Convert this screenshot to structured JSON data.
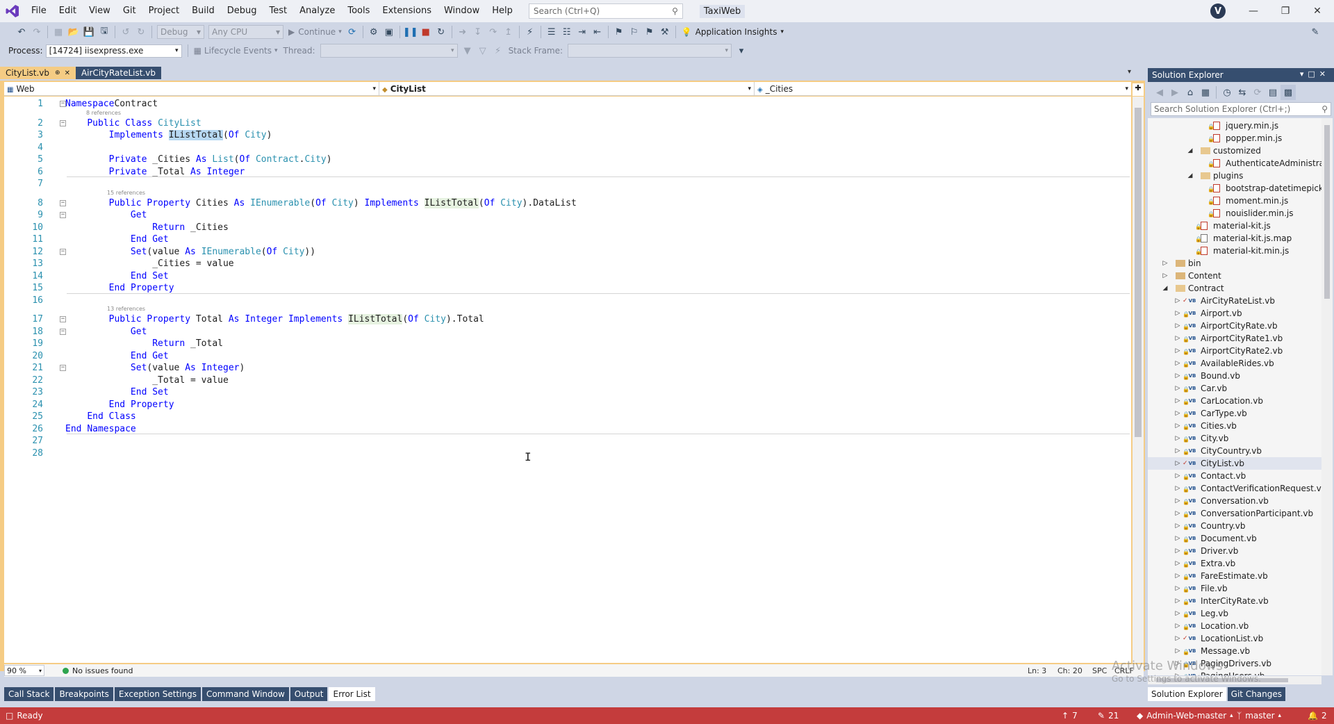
{
  "titlebar": {
    "menu": [
      "File",
      "Edit",
      "View",
      "Git",
      "Project",
      "Build",
      "Debug",
      "Test",
      "Analyze",
      "Tools",
      "Extensions",
      "Window",
      "Help"
    ],
    "search_placeholder": "Search (Ctrl+Q)",
    "solution_name": "TaxiWeb",
    "avatar_initial": "V"
  },
  "toolbar": {
    "config": "Debug",
    "platform": "Any CPU",
    "continue_label": "Continue",
    "app_insights_label": "Application Insights"
  },
  "debug_bar": {
    "process_label": "Process:",
    "process_value": "[14724] iisexpress.exe",
    "lifecycle_label": "Lifecycle Events",
    "thread_label": "Thread:",
    "stack_frame_label": "Stack Frame:"
  },
  "tabs": [
    {
      "label": "CityList.vb",
      "active": true
    },
    {
      "label": "AirCityRateList.vb",
      "active": false
    }
  ],
  "navbar": {
    "project": "Web",
    "type": "CityList",
    "member": "_Cities"
  },
  "code": {
    "lines": [
      {
        "n": "1",
        "tokens": [
          [
            "kw",
            "Namespace"
          ],
          [
            "",
            "Contract"
          ]
        ]
      },
      {
        "n": "2",
        "tokens": [
          [
            "",
            "    "
          ],
          [
            "kw",
            "Public"
          ],
          [
            "",
            " "
          ],
          [
            "kw",
            "Class"
          ],
          [
            "",
            " "
          ],
          [
            "ty",
            "CityList"
          ]
        ]
      },
      {
        "n": "3",
        "tokens": [
          [
            "",
            "        "
          ],
          [
            "kw",
            "Implements"
          ],
          [
            "",
            " "
          ],
          [
            "hl",
            "IListTotal"
          ],
          [
            "",
            "("
          ],
          [
            "kw",
            "Of"
          ],
          [
            "",
            " "
          ],
          [
            "ty",
            "City"
          ],
          [
            "",
            ")"
          ]
        ]
      },
      {
        "n": "4",
        "tokens": []
      },
      {
        "n": "5",
        "tokens": [
          [
            "",
            "        "
          ],
          [
            "kw",
            "Private"
          ],
          [
            "",
            " _Cities "
          ],
          [
            "kw",
            "As"
          ],
          [
            "",
            " "
          ],
          [
            "ty",
            "List"
          ],
          [
            "",
            "("
          ],
          [
            "kw",
            "Of"
          ],
          [
            "",
            " "
          ],
          [
            "ty",
            "Contract"
          ],
          [
            "",
            "."
          ],
          [
            "ty",
            "City"
          ],
          [
            "",
            ")"
          ]
        ]
      },
      {
        "n": "6",
        "tokens": [
          [
            "",
            "        "
          ],
          [
            "kw",
            "Private"
          ],
          [
            "",
            " _Total "
          ],
          [
            "kw",
            "As"
          ],
          [
            "",
            " "
          ],
          [
            "kw",
            "Integer"
          ]
        ]
      },
      {
        "n": "7",
        "tokens": []
      },
      {
        "n": "8",
        "tokens": [
          [
            "",
            "        "
          ],
          [
            "kw",
            "Public"
          ],
          [
            "",
            " "
          ],
          [
            "kw",
            "Property"
          ],
          [
            "",
            " Cities "
          ],
          [
            "kw",
            "As"
          ],
          [
            "",
            " "
          ],
          [
            "ty",
            "IEnumerable"
          ],
          [
            "",
            "("
          ],
          [
            "kw",
            "Of"
          ],
          [
            "",
            " "
          ],
          [
            "ty",
            "City"
          ],
          [
            "",
            ") "
          ],
          [
            "kw",
            "Implements"
          ],
          [
            "",
            " "
          ],
          [
            "ul",
            "IListTotal"
          ],
          [
            "",
            "("
          ],
          [
            "kw",
            "Of"
          ],
          [
            "",
            " "
          ],
          [
            "ty",
            "City"
          ],
          [
            "",
            ").DataList"
          ]
        ]
      },
      {
        "n": "9",
        "tokens": [
          [
            "",
            "            "
          ],
          [
            "kw",
            "Get"
          ]
        ]
      },
      {
        "n": "10",
        "tokens": [
          [
            "",
            "                "
          ],
          [
            "kw",
            "Return"
          ],
          [
            "",
            " _Cities"
          ]
        ]
      },
      {
        "n": "11",
        "tokens": [
          [
            "",
            "            "
          ],
          [
            "kw",
            "End"
          ],
          [
            "",
            " "
          ],
          [
            "kw",
            "Get"
          ]
        ]
      },
      {
        "n": "12",
        "tokens": [
          [
            "",
            "            "
          ],
          [
            "kw",
            "Set"
          ],
          [
            "",
            "(value "
          ],
          [
            "kw",
            "As"
          ],
          [
            "",
            " "
          ],
          [
            "ty",
            "IEnumerable"
          ],
          [
            "",
            "("
          ],
          [
            "kw",
            "Of"
          ],
          [
            "",
            " "
          ],
          [
            "ty",
            "City"
          ],
          [
            "",
            "))"
          ]
        ]
      },
      {
        "n": "13",
        "tokens": [
          [
            "",
            "                _Cities = value"
          ]
        ]
      },
      {
        "n": "14",
        "tokens": [
          [
            "",
            "            "
          ],
          [
            "kw",
            "End"
          ],
          [
            "",
            " "
          ],
          [
            "kw",
            "Set"
          ]
        ]
      },
      {
        "n": "15",
        "tokens": [
          [
            "",
            "        "
          ],
          [
            "kw",
            "End"
          ],
          [
            "",
            " "
          ],
          [
            "kw",
            "Property"
          ]
        ]
      },
      {
        "n": "16",
        "tokens": []
      },
      {
        "n": "17",
        "tokens": [
          [
            "",
            "        "
          ],
          [
            "kw",
            "Public"
          ],
          [
            "",
            " "
          ],
          [
            "kw",
            "Property"
          ],
          [
            "",
            " Total "
          ],
          [
            "kw",
            "As"
          ],
          [
            "",
            " "
          ],
          [
            "kw",
            "Integer"
          ],
          [
            "",
            " "
          ],
          [
            "kw",
            "Implements"
          ],
          [
            "",
            " "
          ],
          [
            "ul",
            "IListTotal"
          ],
          [
            "",
            "("
          ],
          [
            "kw",
            "Of"
          ],
          [
            "",
            " "
          ],
          [
            "ty",
            "City"
          ],
          [
            "",
            ").Total"
          ]
        ]
      },
      {
        "n": "18",
        "tokens": [
          [
            "",
            "            "
          ],
          [
            "kw",
            "Get"
          ]
        ]
      },
      {
        "n": "19",
        "tokens": [
          [
            "",
            "                "
          ],
          [
            "kw",
            "Return"
          ],
          [
            "",
            " _Total"
          ]
        ]
      },
      {
        "n": "20",
        "tokens": [
          [
            "",
            "            "
          ],
          [
            "kw",
            "End"
          ],
          [
            "",
            " "
          ],
          [
            "kw",
            "Get"
          ]
        ]
      },
      {
        "n": "21",
        "tokens": [
          [
            "",
            "            "
          ],
          [
            "kw",
            "Set"
          ],
          [
            "",
            "(value "
          ],
          [
            "kw",
            "As"
          ],
          [
            "",
            " "
          ],
          [
            "kw",
            "Integer"
          ],
          [
            "",
            ")"
          ]
        ]
      },
      {
        "n": "22",
        "tokens": [
          [
            "",
            "                _Total = value"
          ]
        ]
      },
      {
        "n": "23",
        "tokens": [
          [
            "",
            "            "
          ],
          [
            "kw",
            "End"
          ],
          [
            "",
            " "
          ],
          [
            "kw",
            "Set"
          ]
        ]
      },
      {
        "n": "24",
        "tokens": [
          [
            "",
            "        "
          ],
          [
            "kw",
            "End"
          ],
          [
            "",
            " "
          ],
          [
            "kw",
            "Property"
          ]
        ]
      },
      {
        "n": "25",
        "tokens": [
          [
            "",
            "    "
          ],
          [
            "kw",
            "End"
          ],
          [
            "",
            " "
          ],
          [
            "kw",
            "Class"
          ]
        ]
      },
      {
        "n": "26",
        "tokens": [
          [
            "kw",
            "End"
          ],
          [
            "",
            " "
          ],
          [
            "kw",
            "Namespace"
          ]
        ]
      },
      {
        "n": "27",
        "tokens": []
      },
      {
        "n": "28",
        "tokens": []
      }
    ],
    "refs": [
      {
        "after_line": 1,
        "text": "8 references"
      },
      {
        "after_line": 7,
        "text": "15 references"
      },
      {
        "after_line": 16,
        "text": "13 references"
      }
    ]
  },
  "editor_status": {
    "zoom": "90 %",
    "issues": "No issues found",
    "line": "Ln: 3",
    "col": "Ch: 20",
    "spc": "SPC",
    "eol": "CRLF"
  },
  "bottom_tabs": [
    {
      "label": "Call Stack",
      "active": false
    },
    {
      "label": "Breakpoints",
      "active": false
    },
    {
      "label": "Exception Settings",
      "active": false
    },
    {
      "label": "Command Window",
      "active": false
    },
    {
      "label": "Output",
      "active": false
    },
    {
      "label": "Error List",
      "active": true
    }
  ],
  "solution_explorer": {
    "title": "Solution Explorer",
    "search_placeholder": "Search Solution Explorer (Ctrl+;)",
    "items": [
      {
        "indent": 4,
        "expander": "",
        "status": "lock",
        "icon": "js",
        "name": "jquery.min.js"
      },
      {
        "indent": 4,
        "expander": "",
        "status": "lock",
        "icon": "js",
        "name": "popper.min.js"
      },
      {
        "indent": 3,
        "expander": "open",
        "status": "",
        "icon": "folder-open",
        "name": "customized"
      },
      {
        "indent": 4,
        "expander": "",
        "status": "lock",
        "icon": "js",
        "name": "AuthenticateAdministrator.js"
      },
      {
        "indent": 3,
        "expander": "open",
        "status": "",
        "icon": "folder-open",
        "name": "plugins"
      },
      {
        "indent": 4,
        "expander": "",
        "status": "lock",
        "icon": "js",
        "name": "bootstrap-datetimepicker.js"
      },
      {
        "indent": 4,
        "expander": "",
        "status": "lock",
        "icon": "js",
        "name": "moment.min.js"
      },
      {
        "indent": 4,
        "expander": "",
        "status": "lock",
        "icon": "js",
        "name": "nouislider.min.js"
      },
      {
        "indent": 3,
        "expander": "",
        "status": "lock",
        "icon": "js",
        "name": "material-kit.js"
      },
      {
        "indent": 3,
        "expander": "",
        "status": "lock",
        "icon": "map",
        "name": "material-kit.js.map"
      },
      {
        "indent": 3,
        "expander": "",
        "status": "lock",
        "icon": "js",
        "name": "material-kit.min.js"
      },
      {
        "indent": 1,
        "expander": "closed",
        "status": "",
        "icon": "folder",
        "name": "bin"
      },
      {
        "indent": 1,
        "expander": "closed",
        "status": "",
        "icon": "folder",
        "name": "Content"
      },
      {
        "indent": 1,
        "expander": "open",
        "status": "",
        "icon": "folder-open",
        "name": "Contract"
      },
      {
        "indent": 2,
        "expander": "closed",
        "status": "check",
        "icon": "vb",
        "name": "AirCityRateList.vb"
      },
      {
        "indent": 2,
        "expander": "closed",
        "status": "lock",
        "icon": "vb",
        "name": "Airport.vb"
      },
      {
        "indent": 2,
        "expander": "closed",
        "status": "lock",
        "icon": "vb",
        "name": "AirportCityRate.vb"
      },
      {
        "indent": 2,
        "expander": "closed",
        "status": "lock",
        "icon": "vb",
        "name": "AirportCityRate1.vb"
      },
      {
        "indent": 2,
        "expander": "closed",
        "status": "lock",
        "icon": "vb",
        "name": "AirportCityRate2.vb"
      },
      {
        "indent": 2,
        "expander": "closed",
        "status": "lock",
        "icon": "vb",
        "name": "AvailableRides.vb"
      },
      {
        "indent": 2,
        "expander": "closed",
        "status": "lock",
        "icon": "vb",
        "name": "Bound.vb"
      },
      {
        "indent": 2,
        "expander": "closed",
        "status": "lock",
        "icon": "vb",
        "name": "Car.vb"
      },
      {
        "indent": 2,
        "expander": "closed",
        "status": "lock",
        "icon": "vb",
        "name": "CarLocation.vb"
      },
      {
        "indent": 2,
        "expander": "closed",
        "status": "lock",
        "icon": "vb",
        "name": "CarType.vb"
      },
      {
        "indent": 2,
        "expander": "closed",
        "status": "lock",
        "icon": "vb",
        "name": "Cities.vb"
      },
      {
        "indent": 2,
        "expander": "closed",
        "status": "lock",
        "icon": "vb",
        "name": "City.vb"
      },
      {
        "indent": 2,
        "expander": "closed",
        "status": "lock",
        "icon": "vb",
        "name": "CityCountry.vb"
      },
      {
        "indent": 2,
        "expander": "closed",
        "status": "check",
        "icon": "vb",
        "name": "CityList.vb",
        "selected": true
      },
      {
        "indent": 2,
        "expander": "closed",
        "status": "lock",
        "icon": "vb",
        "name": "Contact.vb"
      },
      {
        "indent": 2,
        "expander": "closed",
        "status": "lock",
        "icon": "vb",
        "name": "ContactVerificationRequest.vb"
      },
      {
        "indent": 2,
        "expander": "closed",
        "status": "lock",
        "icon": "vb",
        "name": "Conversation.vb"
      },
      {
        "indent": 2,
        "expander": "closed",
        "status": "lock",
        "icon": "vb",
        "name": "ConversationParticipant.vb"
      },
      {
        "indent": 2,
        "expander": "closed",
        "status": "lock",
        "icon": "vb",
        "name": "Country.vb"
      },
      {
        "indent": 2,
        "expander": "closed",
        "status": "lock",
        "icon": "vb",
        "name": "Document.vb"
      },
      {
        "indent": 2,
        "expander": "closed",
        "status": "lock",
        "icon": "vb",
        "name": "Driver.vb"
      },
      {
        "indent": 2,
        "expander": "closed",
        "status": "lock",
        "icon": "vb",
        "name": "Extra.vb"
      },
      {
        "indent": 2,
        "expander": "closed",
        "status": "lock",
        "icon": "vb",
        "name": "FareEstimate.vb"
      },
      {
        "indent": 2,
        "expander": "closed",
        "status": "lock",
        "icon": "vb",
        "name": "File.vb"
      },
      {
        "indent": 2,
        "expander": "closed",
        "status": "lock",
        "icon": "vb",
        "name": "InterCityRate.vb"
      },
      {
        "indent": 2,
        "expander": "closed",
        "status": "lock",
        "icon": "vb",
        "name": "Leg.vb"
      },
      {
        "indent": 2,
        "expander": "closed",
        "status": "lock",
        "icon": "vb",
        "name": "Location.vb"
      },
      {
        "indent": 2,
        "expander": "closed",
        "status": "check",
        "icon": "vb",
        "name": "LocationList.vb"
      },
      {
        "indent": 2,
        "expander": "closed",
        "status": "lock",
        "icon": "vb",
        "name": "Message.vb"
      },
      {
        "indent": 2,
        "expander": "closed",
        "status": "lock",
        "icon": "vb",
        "name": "PagingDrivers.vb"
      },
      {
        "indent": 2,
        "expander": "closed",
        "status": "lock",
        "icon": "vb",
        "name": "PagingUsers.vb"
      }
    ],
    "bottom_tabs": [
      {
        "label": "Solution Explorer",
        "active": true
      },
      {
        "label": "Git Changes",
        "active": false
      }
    ]
  },
  "watermark": {
    "title": "Activate Windows",
    "subtitle": "Go to Settings to activate Windows."
  },
  "statusbar": {
    "ready": "Ready",
    "commits_up": "7",
    "changes": "21",
    "repo": "Admin-Web-master",
    "branch": "master",
    "notifications": "2"
  },
  "colors": {
    "accent": "#c43c3c",
    "active_tab": "#f5cc84",
    "panel_header": "#364e6f",
    "keyword": "#0000ff",
    "type": "#2b91af"
  }
}
